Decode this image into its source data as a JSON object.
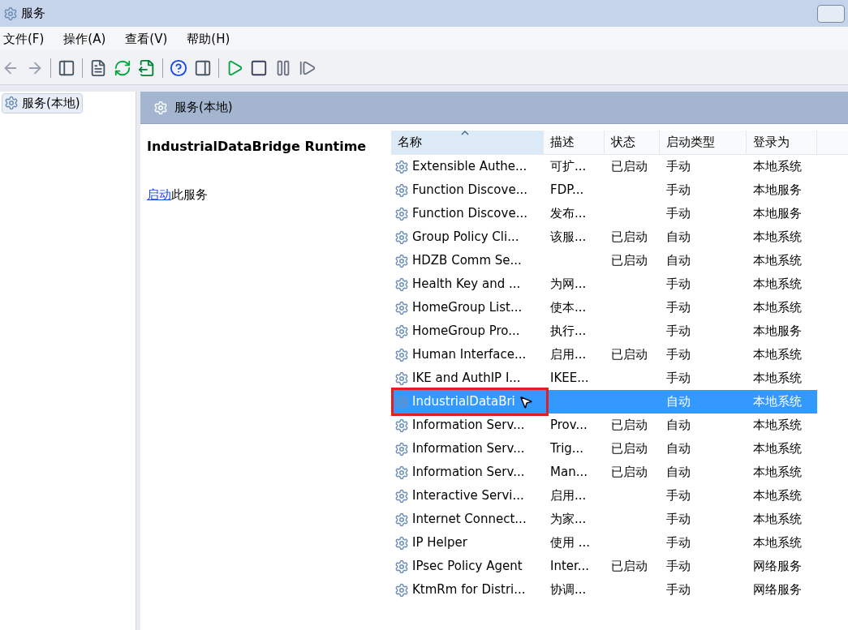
{
  "window": {
    "title": "服务"
  },
  "menu": [
    "文件(F)",
    "操作(A)",
    "查看(V)",
    "帮助(H)"
  ],
  "tree": [
    {
      "label": "服务(本地)",
      "selected": true
    }
  ],
  "panel": {
    "title": "服务(本地)"
  },
  "details": {
    "service_name": "IndustrialDataBridge Runtime",
    "action_link": "启动",
    "action_text": "此服务"
  },
  "table": {
    "columns": [
      {
        "label": "名称",
        "sorted": true
      },
      {
        "label": "描述",
        "sorted": false
      },
      {
        "label": "状态",
        "sorted": false
      },
      {
        "label": "启动类型",
        "sorted": false
      },
      {
        "label": "登录为",
        "sorted": false
      }
    ],
    "rows": [
      {
        "name": "Extensible Authe...",
        "description": "可扩...",
        "status": "已启动",
        "startup": "手动",
        "logon": "本地系统",
        "selected": false
      },
      {
        "name": "Function Discove...",
        "description": "FDP...",
        "status": "",
        "startup": "手动",
        "logon": "本地服务",
        "selected": false
      },
      {
        "name": "Function Discove...",
        "description": "发布...",
        "status": "",
        "startup": "手动",
        "logon": "本地服务",
        "selected": false
      },
      {
        "name": "Group Policy Cli...",
        "description": "该服...",
        "status": "已启动",
        "startup": "自动",
        "logon": "本地系统",
        "selected": false
      },
      {
        "name": "HDZB Comm Se...",
        "description": "",
        "status": "已启动",
        "startup": "自动",
        "logon": "本地系统",
        "selected": false
      },
      {
        "name": "Health Key and ...",
        "description": "为网...",
        "status": "",
        "startup": "手动",
        "logon": "本地系统",
        "selected": false
      },
      {
        "name": "HomeGroup List...",
        "description": "使本...",
        "status": "",
        "startup": "手动",
        "logon": "本地系统",
        "selected": false
      },
      {
        "name": "HomeGroup Pro...",
        "description": "执行...",
        "status": "",
        "startup": "手动",
        "logon": "本地服务",
        "selected": false
      },
      {
        "name": "Human Interface...",
        "description": "启用...",
        "status": "已启动",
        "startup": "手动",
        "logon": "本地系统",
        "selected": false
      },
      {
        "name": "IKE and AuthIP I...",
        "description": "IKEE...",
        "status": "",
        "startup": "手动",
        "logon": "本地系统",
        "selected": false
      },
      {
        "name": "IndustrialDataBri",
        "description": "",
        "status": "",
        "startup": "自动",
        "logon": "本地系统",
        "selected": true
      },
      {
        "name": "Information Serv...",
        "description": "Prov...",
        "status": "已启动",
        "startup": "自动",
        "logon": "本地系统",
        "selected": false
      },
      {
        "name": "Information Serv...",
        "description": "Trig...",
        "status": "已启动",
        "startup": "自动",
        "logon": "本地系统",
        "selected": false
      },
      {
        "name": "Information Serv...",
        "description": "Man...",
        "status": "已启动",
        "startup": "自动",
        "logon": "本地系统",
        "selected": false
      },
      {
        "name": "Interactive Servi...",
        "description": "启用...",
        "status": "",
        "startup": "手动",
        "logon": "本地系统",
        "selected": false
      },
      {
        "name": "Internet Connect...",
        "description": "为家...",
        "status": "",
        "startup": "手动",
        "logon": "本地系统",
        "selected": false
      },
      {
        "name": "IP Helper",
        "description": "使用 ...",
        "status": "",
        "startup": "手动",
        "logon": "本地系统",
        "selected": false
      },
      {
        "name": "IPsec Policy Agent",
        "description": "Inter...",
        "status": "已启动",
        "startup": "手动",
        "logon": "网络服务",
        "selected": false
      },
      {
        "name": "KtmRm for Distri...",
        "description": "协调...",
        "status": "",
        "startup": "手动",
        "logon": "网络服务",
        "selected": false
      }
    ]
  }
}
